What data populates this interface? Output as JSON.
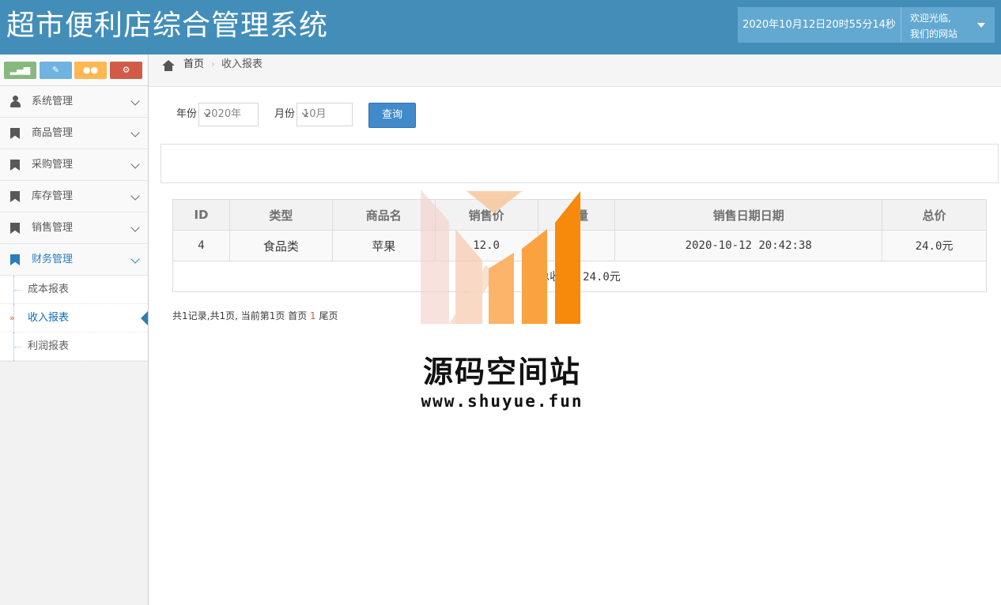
{
  "header": {
    "title": "超市便利店综合管理系统",
    "datetime": "2020年10月12日20时55分14秒",
    "welcome": "欢迎光临,",
    "user": "我们的网站"
  },
  "shortcuts": [
    "signal-icon",
    "pencil-icon",
    "users-icon",
    "cogs-icon"
  ],
  "sidebar": {
    "items": [
      {
        "label": "系统管理",
        "icon": "user-icon"
      },
      {
        "label": "商品管理",
        "icon": "bookmark-icon"
      },
      {
        "label": "采购管理",
        "icon": "bookmark-icon"
      },
      {
        "label": "库存管理",
        "icon": "bookmark-icon"
      },
      {
        "label": "销售管理",
        "icon": "bookmark-icon"
      },
      {
        "label": "财务管理",
        "icon": "bookmark-icon"
      }
    ],
    "submenu": [
      {
        "label": "成本报表"
      },
      {
        "label": "收入报表"
      },
      {
        "label": "利润报表"
      }
    ]
  },
  "breadcrumb": {
    "home": "首页",
    "current": "收入报表"
  },
  "search": {
    "year_label": "年份",
    "year_value": "2020年",
    "month_label": "月份",
    "month_value": "10月",
    "query_button": "查询"
  },
  "table": {
    "headers": [
      "ID",
      "类型",
      "商品名",
      "销售价",
      "数量",
      "销售日期日期",
      "总价"
    ],
    "rows": [
      [
        "4",
        "食品类",
        "苹果",
        "12.0",
        "2",
        "2020-10-12 20:42:38",
        "24.0元"
      ]
    ],
    "total": "总收入：24.0元"
  },
  "pager": {
    "summary": "共1记录,共1页, 当前第1页",
    "first": "首页",
    "current": "1",
    "last": "尾页"
  },
  "watermark": {
    "text": "源码空间站",
    "url": "www.shuyue.fun"
  },
  "colors": {
    "header_bg": "#438eb9",
    "accent": "#2b7dbc",
    "watermark_orange": "#f7890b"
  }
}
